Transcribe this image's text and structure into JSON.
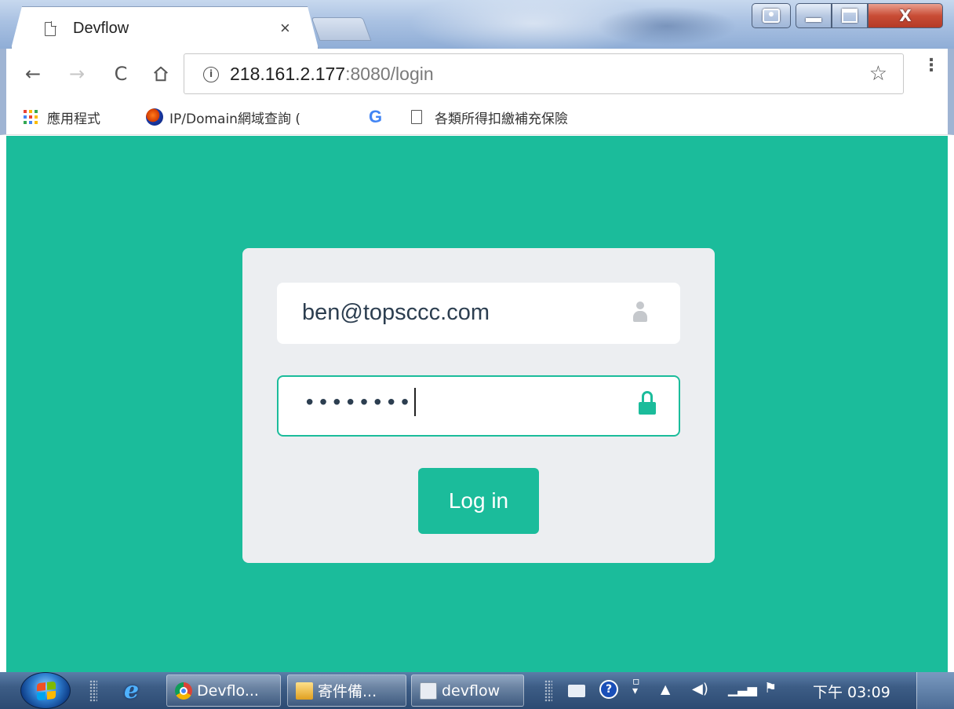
{
  "window": {
    "tab_title": "Devflow",
    "tab_close": "×"
  },
  "toolbar": {
    "back": "←",
    "forward": "→",
    "reload": "C",
    "url_host": "218.161.2.177",
    "url_rest": ":8080/login",
    "info_icon": "i",
    "star": "☆",
    "menu": "⋮"
  },
  "bookmarks": [
    {
      "label": "應用程式",
      "icon": "apps-grid-icon"
    },
    {
      "label": "IP/Domain網域查詢 (",
      "icon": "ip-domain-icon"
    },
    {
      "label": "G",
      "icon": "google-icon"
    },
    {
      "label": "各類所得扣繳補充保險",
      "icon": "document-icon"
    }
  ],
  "apps_grid_colors": [
    "#ea4335",
    "#fbbc05",
    "#34a853",
    "#4285f4",
    "#ea4335",
    "#fbbc05",
    "#34a853",
    "#4285f4",
    "#fbbc05"
  ],
  "login": {
    "email_value": "ben@topsccc.com",
    "password_mask": "••••••••",
    "submit_label": "Log in"
  },
  "colors": {
    "page_background": "#1bbc9b",
    "card_background": "#eceef1",
    "accent": "#1bbc9b"
  },
  "taskbar": {
    "items": [
      {
        "label": "Devflo...",
        "icon": "chrome-icon"
      },
      {
        "label": "寄件備...",
        "icon": "outbox-icon"
      },
      {
        "label": "devflow",
        "icon": "mail-icon"
      }
    ],
    "help": "?",
    "clock": "下午 03:09"
  }
}
